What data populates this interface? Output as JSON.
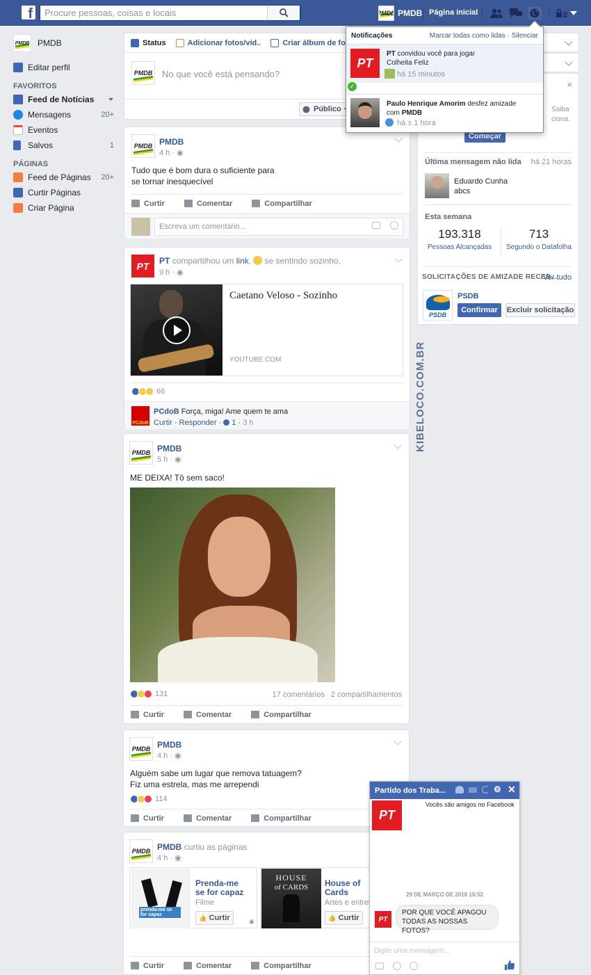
{
  "topbar": {
    "logo": "f",
    "search_placeholder": "Procure pessoas, coisas e locais",
    "profile_name": "PMDB",
    "home": "Página inicial"
  },
  "left_nav": {
    "profile": {
      "name": "PMDB",
      "logo": "PMDB"
    },
    "edit_profile": "Editar perfil",
    "favorites_header": "FAVORITOS",
    "favorites": [
      {
        "label": "Feed de Notícias",
        "count": "",
        "icon": "news-feed-icon"
      },
      {
        "label": "Mensagens",
        "count": "20+",
        "icon": "messages-icon"
      },
      {
        "label": "Eventos",
        "count": "",
        "icon": "calendar-icon"
      },
      {
        "label": "Salvos",
        "count": "1",
        "icon": "bookmark-icon"
      }
    ],
    "pages_header": "PÁGINAS",
    "pages": [
      {
        "label": "Feed de Páginas",
        "count": "20+"
      },
      {
        "label": "Curtir Páginas",
        "count": ""
      },
      {
        "label": "Criar Página",
        "count": ""
      }
    ]
  },
  "composer": {
    "tabs": [
      "Status",
      "Adicionar fotos/víd..",
      "Criar álbum de foto"
    ],
    "placeholder": "No que você está pensando?",
    "audience": "Público"
  },
  "posts": {
    "p1": {
      "author": "PMDB",
      "time": "4 h",
      "text1": "Tudo que é bom dura o suficiente para",
      "text2": "se tornar inesquecível",
      "comment_placeholder": "Escreva um comentário..."
    },
    "p2": {
      "author": "PT",
      "action": "compartilhou um",
      "link_word": "link",
      "feeling": "se sentindo sozinho.",
      "time": "9 h",
      "link_title": "Caetano Veloso - Sozinho",
      "link_domain": "YOUTUBE.COM",
      "reactions": "66",
      "comment": {
        "author": "PCdoB",
        "text": "Força, miga! Ame quem te ama",
        "like": "Curtir",
        "reply": "Responder",
        "likes": "1",
        "time": "3 h"
      }
    },
    "p3": {
      "author": "PMDB",
      "time": "5 h",
      "text": "ME DEIXA! Tô sem saco!",
      "reactions": "131",
      "comments": "17 comentários",
      "shares": "2 compartilhamentos"
    },
    "p4": {
      "author": "PMDB",
      "time": "4 h",
      "text1": "Alguém sabe um lugar que remova tatuagem?",
      "text2": "Fiz uma estrela, mas me arrependi",
      "reactions": "114"
    },
    "p5": {
      "author": "PMDB",
      "action": "curtiu as páginas",
      "time": "4 h",
      "pages": [
        {
          "title1": "Prenda-me",
          "title2": "se for capaz",
          "category": "Filme",
          "like": "Curtir",
          "poster": "prenda-me se for capaz"
        },
        {
          "title1": "House of",
          "title2": "Cards",
          "category": "Artes e entrete",
          "like": "Curtir",
          "poster1": "HOUSE",
          "poster2": "of CARDS"
        }
      ]
    }
  },
  "actions": {
    "like": "Curtir",
    "comment": "Comentar",
    "share": "Compartilhar"
  },
  "notifications": {
    "title": "Notificações",
    "mark_read": "Marcar todas como lidas",
    "separator": "·",
    "mute": "Silenciar",
    "items": [
      {
        "actor": "PT",
        "text1": "convidou você para jogar",
        "text2": "Colheita Feliz",
        "time": "há 15 minutos"
      },
      {
        "actor": "Paulo Henrique Amorim",
        "text1": "desfez amizade",
        "text2a": "com",
        "text2b": "PMDB",
        "time": "há ± 1 hora"
      }
    ]
  },
  "right_col": {
    "saiba": "Saiba",
    "ciona": "ciona.",
    "comecar": "Começar",
    "unread_label": "Última mensagem não lida",
    "unread_time": "há 21 horas",
    "unread_name": "Eduardo Cunha",
    "unread_text": "abcs",
    "week_label": "Esta semana",
    "stats": [
      {
        "value": "193.318",
        "label": "Pessoas Alcançadas"
      },
      {
        "value": "713",
        "label": "Segundo o Datafolha"
      }
    ],
    "requests_label": "SOLICITAÇÕES DE AMIZADE RECEB...",
    "see_all": "Ver tudo",
    "request": {
      "name": "PSDB",
      "confirm": "Confirmar",
      "delete": "Excluir solicitação"
    }
  },
  "watermark": "KIBELOCO.COM.BR",
  "chat": {
    "title": "Partido dos Traba...",
    "friends": "Vocês são amigos no Facebook",
    "date": "29 DE MARÇO DE 2016 10:52",
    "message1": "POR QUE VOCÊ APAGOU",
    "message2": "TODAS AS NOSSAS FOTOS?",
    "input_placeholder": "Digite uma mensagem..."
  },
  "colors": {
    "brand": "#3b5998",
    "link": "#365899",
    "pt_red": "#e31b23"
  }
}
